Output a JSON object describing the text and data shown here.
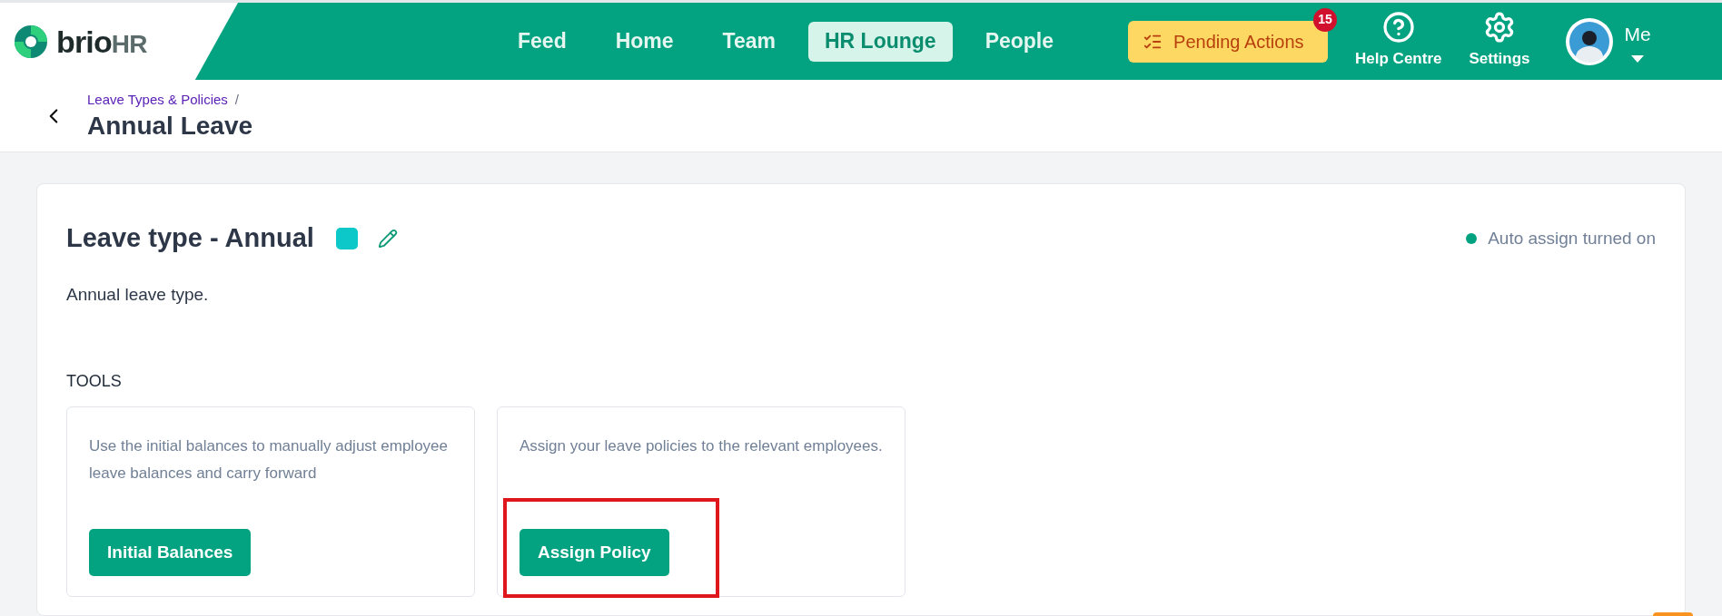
{
  "logo": {
    "word": "brio",
    "suffix": "HR"
  },
  "nav": [
    {
      "label": "Feed",
      "selected": false
    },
    {
      "label": "Home",
      "selected": false
    },
    {
      "label": "Team",
      "selected": false
    },
    {
      "label": "HR Lounge",
      "selected": true
    },
    {
      "label": "People",
      "selected": false
    }
  ],
  "pending_actions": {
    "label": "Pending Actions",
    "count": "15"
  },
  "help": {
    "label": "Help Centre"
  },
  "settings": {
    "label": "Settings"
  },
  "profile": {
    "label": "Me"
  },
  "breadcrumb": {
    "parent": "Leave Types & Policies",
    "separator": "/",
    "title": "Annual Leave"
  },
  "leave_type": {
    "title": "Leave type - Annual",
    "color": "#0cc8c8",
    "description": "Annual leave type.",
    "auto_assign": {
      "label": "Auto assign turned on",
      "on": true
    }
  },
  "tools": {
    "heading": "TOOLS",
    "cards": [
      {
        "description": "Use the initial balances to manually adjust employee leave balances and carry forward",
        "button": "Initial Balances",
        "highlighted": false
      },
      {
        "description": "Assign your leave policies to the relevant employees.",
        "button": "Assign Policy",
        "highlighted": true
      }
    ]
  }
}
